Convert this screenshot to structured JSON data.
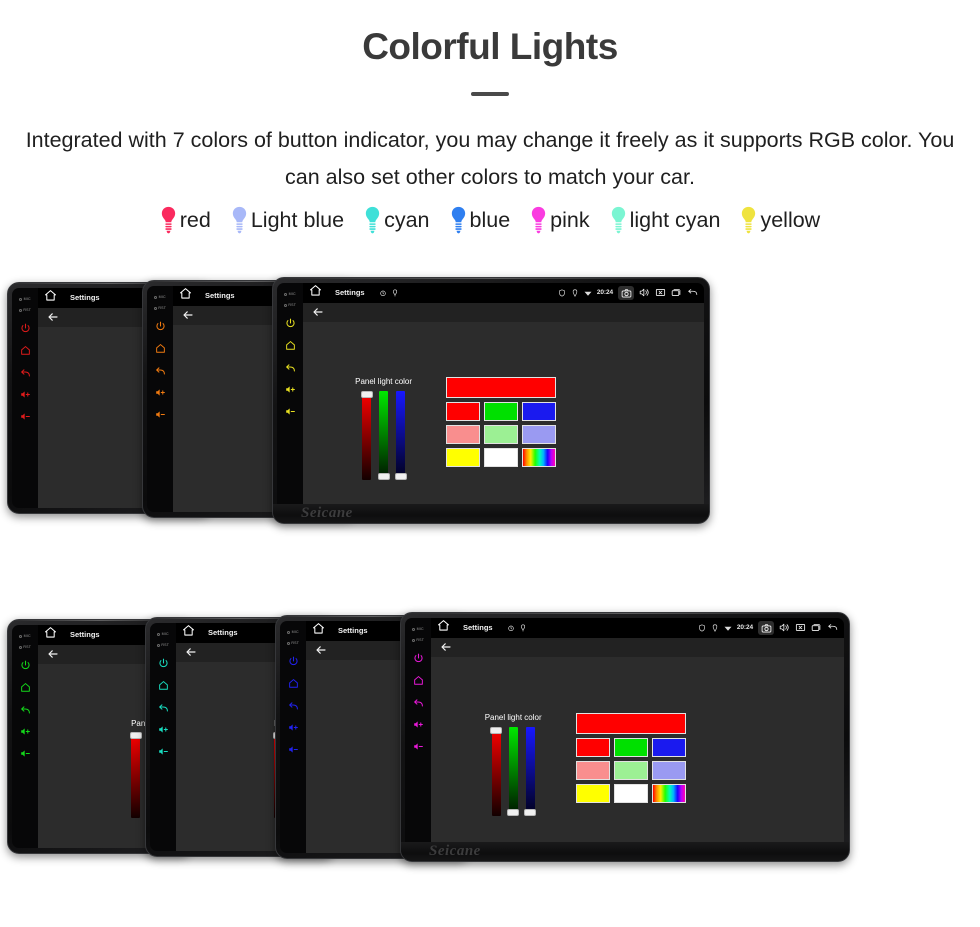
{
  "header": {
    "title": "Colorful Lights",
    "description": "Integrated with 7 colors of button indicator, you may change it freely as it supports RGB color. You can also set other colors to match your car."
  },
  "legend": {
    "icon_name": "light-bulb-icon",
    "items": [
      {
        "label": "red",
        "color": "#fa2a5e"
      },
      {
        "label": "Light blue",
        "color": "#a8b8f8"
      },
      {
        "label": "cyan",
        "color": "#3fe0d8"
      },
      {
        "label": "blue",
        "color": "#2f7ff0"
      },
      {
        "label": "pink",
        "color": "#fa3ce0"
      },
      {
        "label": "light cyan",
        "color": "#7bf5d2"
      },
      {
        "label": "yellow",
        "color": "#efe33f"
      }
    ]
  },
  "device_ui": {
    "brand": "Seicane",
    "hardware_buttons": {
      "mic_label": "MIC",
      "rst_label": "RST",
      "icons": [
        "power-icon",
        "home-icon",
        "back-icon",
        "volume-up-icon",
        "volume-down-icon"
      ]
    },
    "system_bar": {
      "home_icon": "home-icon",
      "title": "Settings",
      "mini_icons": [
        "alarm-icon",
        "location-pin-icon"
      ],
      "status_icons": [
        "shield-icon",
        "location-icon",
        "wifi-icon"
      ],
      "clock": "20:24",
      "right_icons": [
        "camera-icon",
        "volume-icon",
        "close-box-icon",
        "recents-icon",
        "back-icon"
      ]
    },
    "app_bar": {
      "back_icon": "back-arrow-icon"
    },
    "panel": {
      "label": "Panel light color",
      "sliders": [
        {
          "name": "red-slider",
          "channel": "R",
          "knob": "top"
        },
        {
          "name": "green-slider",
          "channel": "G",
          "knob": "bottom"
        },
        {
          "name": "blue-slider",
          "channel": "B",
          "knob": "bottom"
        }
      ],
      "preview_color": "#ff0000",
      "swatches": [
        [
          "#ff0000",
          "#00e000",
          "#1a1aef"
        ],
        [
          "#f98e8e",
          "#9cf094",
          "#9a9af2"
        ],
        [
          "#ffff00",
          "#ffffff",
          "rainbow"
        ]
      ]
    }
  },
  "groups": {
    "top": {
      "name": "top-device-row",
      "devices": [
        {
          "name": "device-red",
          "button_color": "#e01b1b",
          "front": false
        },
        {
          "name": "device-orange",
          "button_color": "#f07a10",
          "front": false
        },
        {
          "name": "device-yellow",
          "button_color": "#e8e020",
          "front": true
        }
      ]
    },
    "bottom": {
      "name": "bottom-device-row",
      "devices": [
        {
          "name": "device-green",
          "button_color": "#14d81a",
          "front": false
        },
        {
          "name": "device-cyan",
          "button_color": "#18ddc0",
          "front": false
        },
        {
          "name": "device-blue",
          "button_color": "#2222f0",
          "front": false
        },
        {
          "name": "device-magenta",
          "button_color": "#e818d8",
          "front": true
        }
      ]
    }
  }
}
